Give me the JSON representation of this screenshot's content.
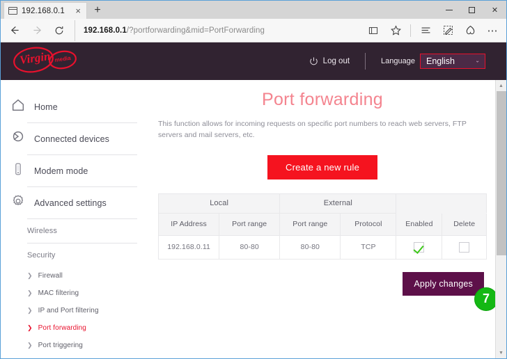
{
  "browser": {
    "tab": {
      "title": "192.168.0.1",
      "favicon": "page-icon",
      "close": "×"
    },
    "new_tab": "+",
    "window_controls": {
      "minimize": "minimize-icon",
      "maximize": "maximize-icon",
      "close": "✕"
    },
    "nav": {
      "back": "←",
      "forward": "→",
      "refresh": "↻",
      "reading_view": "book-icon",
      "favorites": "star-icon",
      "hub": "hub-icon",
      "web_note": "pen-icon",
      "share": "share-icon",
      "more": "⋯"
    },
    "url": {
      "host": "192.168.0.1",
      "path": "/?portforwarding&mid=PortForwarding"
    }
  },
  "header": {
    "logo_brand": "Virgin",
    "logo_sub": "media",
    "logout_label": "Log out",
    "logout_icon": "power-icon",
    "language_label": "Language",
    "language_value": "English",
    "language_options": [
      "English"
    ],
    "chevron": "⌄",
    "bg_color": "#312331",
    "accent_red": "#e8112d"
  },
  "sidebar": {
    "items": [
      {
        "label": "Home",
        "icon": "home-icon"
      },
      {
        "label": "Connected devices",
        "icon": "devices-icon"
      },
      {
        "label": "Modem mode",
        "icon": "modem-icon"
      },
      {
        "label": "Advanced settings",
        "icon": "gear-icon"
      }
    ],
    "sections": [
      {
        "label": "Wireless"
      },
      {
        "label": "Security"
      }
    ],
    "security_links": [
      {
        "label": "Firewall",
        "active": false
      },
      {
        "label": "MAC filtering",
        "active": false
      },
      {
        "label": "IP and Port filtering",
        "active": false
      },
      {
        "label": "Port forwarding",
        "active": true
      },
      {
        "label": "Port triggering",
        "active": false
      }
    ],
    "active_color": "#e8112d"
  },
  "main": {
    "title": "Port forwarding",
    "title_color": "#f4848f",
    "description": "This function allows for incoming requests on specific port numbers to reach web servers, FTP servers and mail servers, etc.",
    "create_button": "Create a new rule",
    "create_button_color": "#f5131f",
    "apply_button": "Apply changes",
    "apply_button_color": "#5d1049",
    "step_badge": "7",
    "badge_color": "#14b814",
    "table": {
      "group_headers": [
        "Local",
        "External",
        ""
      ],
      "columns": [
        "IP Address",
        "Port range",
        "Port range",
        "Protocol",
        "Enabled",
        "Delete"
      ],
      "rows": [
        {
          "ip_address": "192.168.0.11",
          "local_port_range": "80-80",
          "external_port_range": "80-80",
          "protocol": "TCP",
          "enabled": true,
          "delete": false
        }
      ]
    }
  }
}
